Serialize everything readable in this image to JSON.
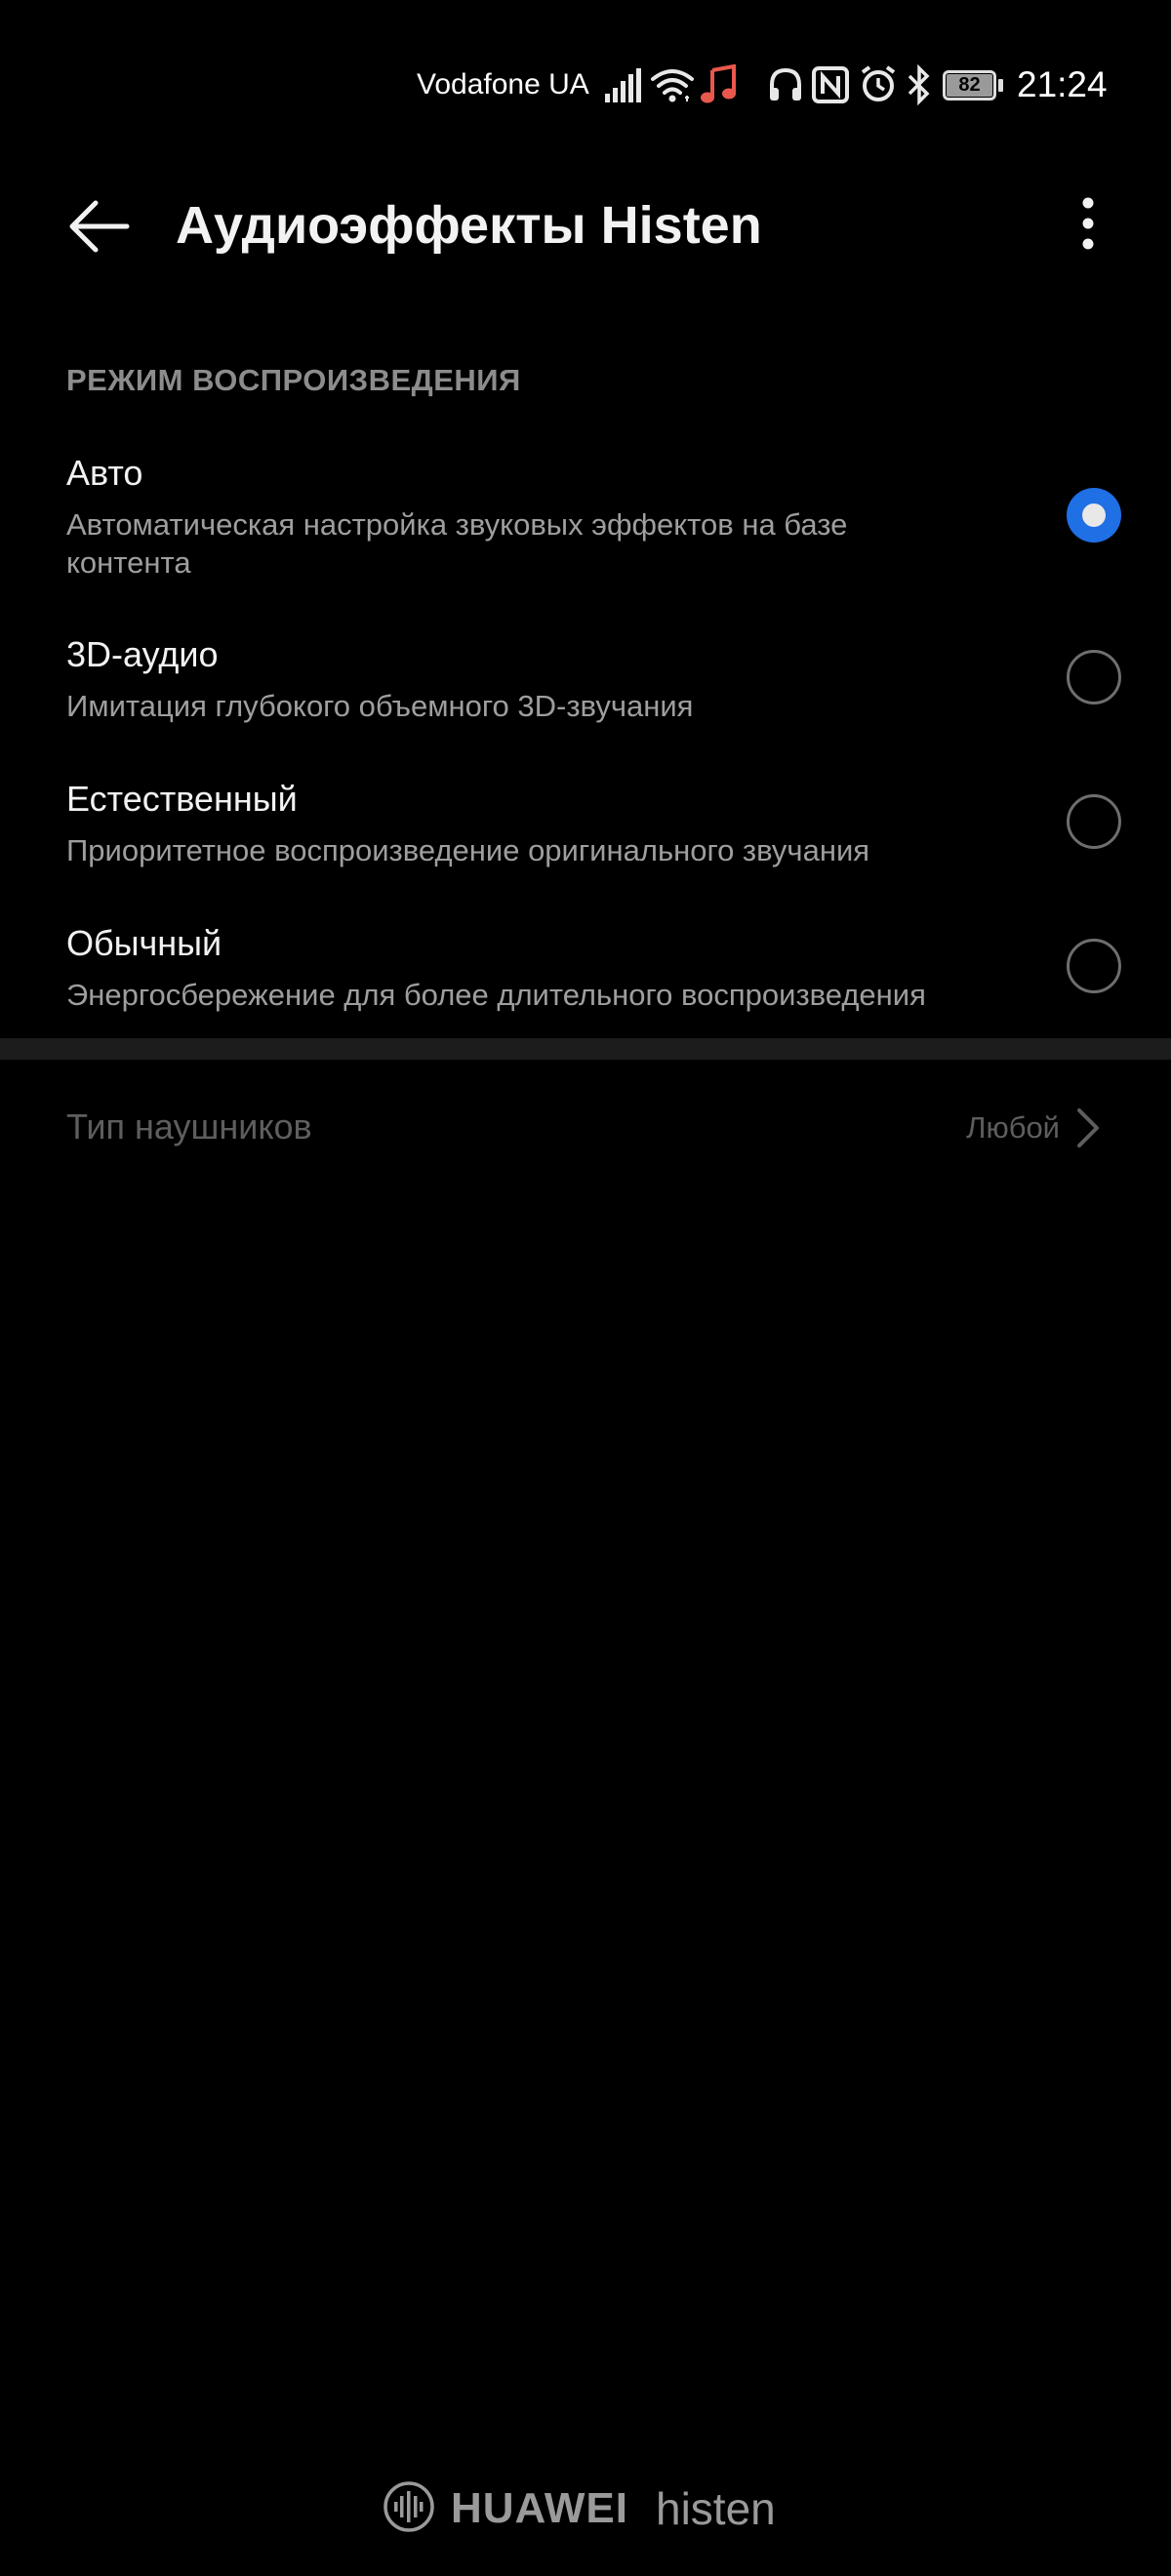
{
  "status_bar": {
    "carrier": "Vodafone UA",
    "battery_level": "82",
    "time": "21:24",
    "icons": [
      "signal-icon",
      "wifi-icon",
      "music-note-icon",
      "headphones-icon",
      "nfc-icon",
      "alarm-icon",
      "bluetooth-icon",
      "battery-icon"
    ],
    "music_icon_color": "#e9584d"
  },
  "app_bar": {
    "title": "Аудиоэффекты Histen",
    "back_icon": "arrow-left-icon",
    "more_icon": "more-vertical-icon"
  },
  "playback_section": {
    "header": "РЕЖИМ ВОСПРОИЗВЕДЕНИЯ",
    "options": [
      {
        "title": "Авто",
        "subtitle": "Автоматическая настройка звуковых эффектов на базе контента",
        "selected": true
      },
      {
        "title": "3D-аудио",
        "subtitle": "Имитация глубокого объемного 3D-звучания",
        "selected": false
      },
      {
        "title": "Естественный",
        "subtitle": "Приоритетное воспроизведение оригинального звучания",
        "selected": false
      },
      {
        "title": "Обычный",
        "subtitle": "Энергосбережение для более длительного воспроизведения",
        "selected": false
      }
    ]
  },
  "headphone_type": {
    "label": "Тип наушников",
    "value": "Любой"
  },
  "footer": {
    "brand_huawei": "HUAWEI",
    "brand_histen": "histen"
  },
  "colors": {
    "accent": "#1f6fe5",
    "background": "#000000",
    "text_primary": "#f2f2f2",
    "text_secondary": "#9e9e9e",
    "text_disabled": "#5e5e5e"
  }
}
